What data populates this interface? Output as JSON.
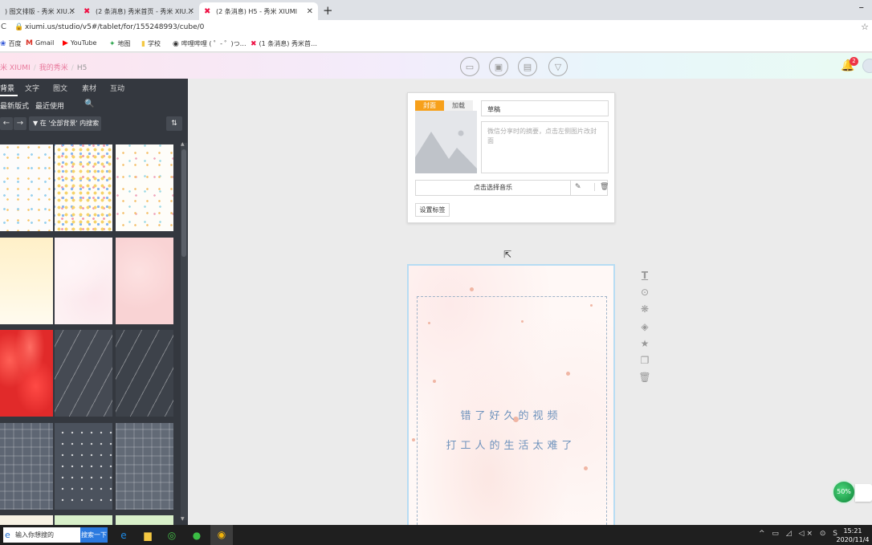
{
  "browser": {
    "tabs": [
      {
        "title": ") 图文排版 - 秀米 XIU…",
        "active": false
      },
      {
        "title": "(2 条消息) 秀米首页 - 秀米 XIU…",
        "active": false
      },
      {
        "title": "(2 条消息) H5 - 秀米 XIUMI",
        "active": true
      }
    ],
    "new_tab": "+",
    "minimize": "–",
    "url": "xiumi.us/studio/v5#/tablet/for/155248993/cube/0",
    "bookmarks": [
      {
        "label": "百度",
        "icon": "paw-icon"
      },
      {
        "label": "Gmail",
        "icon": "gmail-icon"
      },
      {
        "label": "YouTube",
        "icon": "youtube-icon"
      },
      {
        "label": "地图",
        "icon": "map-icon"
      },
      {
        "label": "学校",
        "icon": "folder-icon"
      },
      {
        "label": "哔哩哔哩 ( ゜- ゜)つ…",
        "icon": "globe-icon"
      },
      {
        "label": "(1 条消息) 秀米首…",
        "icon": "xiumi-icon"
      }
    ]
  },
  "header": {
    "crumbs": [
      "米 XIUMI",
      "我的秀米",
      "H5"
    ],
    "notification_count": "2"
  },
  "left_panel": {
    "tabs": [
      "背景",
      "文字",
      "图文",
      "素材",
      "互动"
    ],
    "active_tab": 0,
    "subtabs": [
      "最新版式",
      "最近使用"
    ],
    "scope_label": "在 '全部背景' 内搜索",
    "tiles": [
      "dots-light",
      "dots-colorful",
      "dots-sparse",
      "yellow-gradient",
      "pink-white",
      "pink",
      "red-waves",
      "rain-lines",
      "rain-lines-dark",
      "plaid",
      "drops",
      "plaid-light"
    ]
  },
  "cover_card": {
    "tab_cover": "封面",
    "tab_load": "加载",
    "title_value": "草稿",
    "summary_placeholder": "微信分享时的摘要，点击左侧图片改封面",
    "music_label": "点击选择音乐",
    "tag_button": "设置标签"
  },
  "phone": {
    "line1": "错了好久的视频",
    "line2": "打工人的生活太难了"
  },
  "float_widget": {
    "percent": "50%"
  },
  "taskbar": {
    "search_placeholder": "输入你想搜的",
    "search_button": "搜索一下",
    "time": "15:21",
    "date": "2020/11/4"
  },
  "colors": {
    "accent_pink": "#e8799c",
    "cover_tab": "#f7a01a",
    "panel_bg": "#34383f",
    "phone_text": "#6f93bd"
  }
}
